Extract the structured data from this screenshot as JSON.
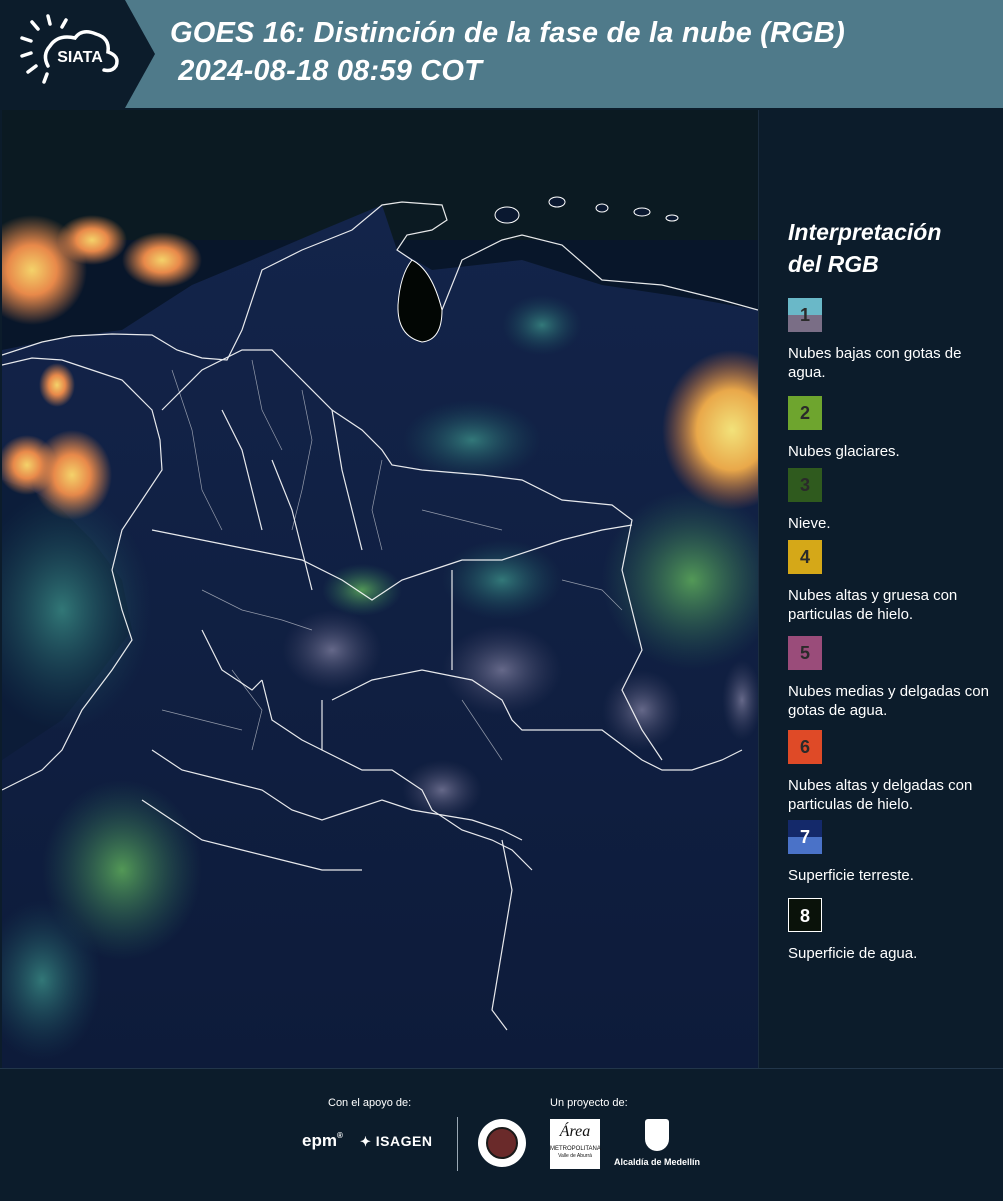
{
  "header": {
    "logo_text": "SIATA",
    "title_line1": "GOES 16: Distinción de la fase de la nube (RGB)",
    "title_line2": " 2024-08-18 08:59 COT",
    "colors": {
      "bar": "#4f7a8a",
      "logo_bg": "#0c1c2b"
    }
  },
  "map": {
    "icon": "satellite-map",
    "background": "#0a1830"
  },
  "legend": {
    "title_line1": "Interpretación",
    "title_line2": "del RGB",
    "items": [
      {
        "number": "1",
        "label": "Nubes bajas con gotas de agua.",
        "color_top": "#6ab8c8",
        "color_bottom": "#7a6e86"
      },
      {
        "number": "2",
        "label": "Nubes glaciares.",
        "color_top": "#6ea52e",
        "color_bottom": "#6ea52e"
      },
      {
        "number": "3",
        "label": "Nieve.",
        "color_top": "#2f5a1e",
        "color_bottom": "#2f5a1e"
      },
      {
        "number": "4",
        "label": "Nubes altas y gruesa con particulas de hielo.",
        "color_top": "#d5a818",
        "color_bottom": "#d5a818"
      },
      {
        "number": "5",
        "label": "Nubes medias y delgadas con gotas de agua.",
        "color_top": "#9a4c7a",
        "color_bottom": "#9a4c7a"
      },
      {
        "number": "6",
        "label": "Nubes altas y delgadas con particulas de hielo.",
        "color_top": "#df4a27",
        "color_bottom": "#df4a27"
      },
      {
        "number": "7",
        "label": "Superficie terreste.",
        "color_top": "#14296a",
        "color_bottom": "#4a72c8"
      },
      {
        "number": "8",
        "label": "Superficie de agua.",
        "color_top": "#0a120a",
        "color_bottom": "#0a120a"
      }
    ]
  },
  "footer": {
    "support_label": "Con el apoyo de:",
    "project_label": "Un proyecto de:",
    "sponsor1": "epm",
    "sponsor2": "ISAGEN",
    "partner1": "METROPOLITANA",
    "partner1_sub": "Valle de Aburrá",
    "partner1_script": "Área",
    "partner2": "Alcaldía de Medellín"
  }
}
